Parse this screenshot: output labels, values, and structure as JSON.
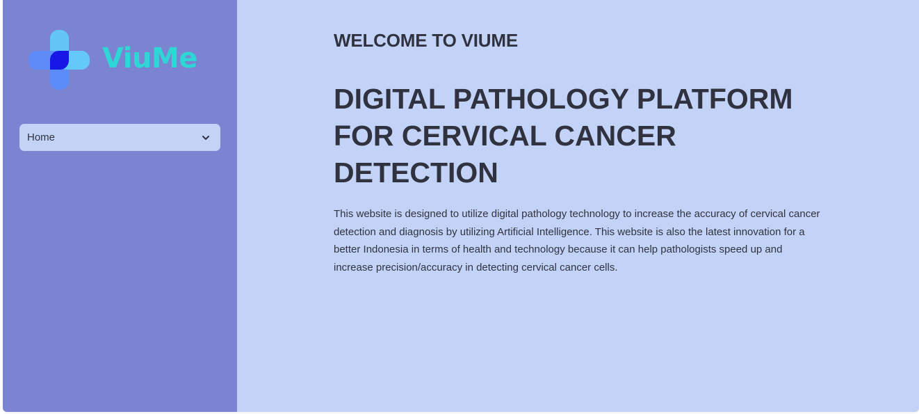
{
  "brand": {
    "name": "ViuMe",
    "logo_icon": "medical-cross-logo-icon",
    "text_color": "#2fd6d6",
    "cross_colors": [
      "#5a8bfa",
      "#64ccf5",
      "#1818e6"
    ]
  },
  "sidebar": {
    "background": "#7b84d0",
    "nav_select": {
      "value": "Home",
      "icon": "chevron-down-icon"
    }
  },
  "main": {
    "background": "#c2d3f7",
    "welcome": "WELCOME TO VIUME",
    "headline": "DIGITAL PATHOLOGY PLATFORM FOR CERVICAL CANCER DETECTION",
    "description": "This website is designed to utilize digital pathology technology to increase the accuracy of cervical cancer detection and diagnosis by utilizing Artificial Intelligence. This website is also the latest innovation for a better Indonesia in terms of health and technology because it can help pathologists speed up and increase precision/accuracy in detecting cervical cancer cells."
  }
}
